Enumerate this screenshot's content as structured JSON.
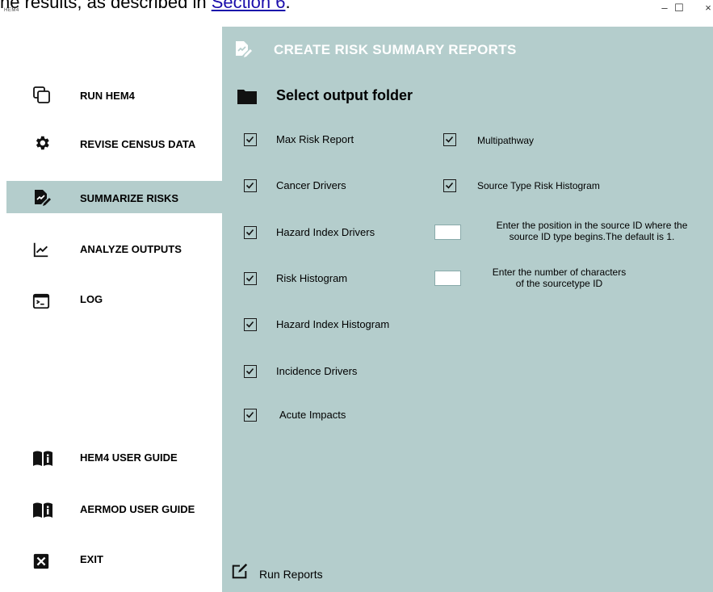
{
  "doc_top": {
    "text": "he results, as described in ",
    "link": "Section 6",
    "punct": "."
  },
  "window": {
    "app_title": "HEM4",
    "minimize": "–",
    "maximize": "☐",
    "close": "×"
  },
  "sidebar": {
    "items": [
      {
        "label": "RUN HEM4",
        "icon": "copy-icon"
      },
      {
        "label": "REVISE CENSUS DATA",
        "icon": "gear-icon"
      },
      {
        "label": "SUMMARIZE RISKS",
        "icon": "edit-document-icon",
        "active": true
      },
      {
        "label": "ANALYZE OUTPUTS",
        "icon": "chart-line-icon"
      },
      {
        "label": "LOG",
        "icon": "terminal-icon"
      },
      {
        "label": "HEM4 USER GUIDE",
        "icon": "book-info-icon"
      },
      {
        "label": "AERMOD USER GUIDE",
        "icon": "book-info-icon"
      },
      {
        "label": "EXIT",
        "icon": "close-box-icon"
      }
    ]
  },
  "main": {
    "title": "CREATE RISK SUMMARY REPORTS",
    "folder_label": "Select output folder",
    "left_checks": [
      {
        "label": "Max Risk Report",
        "checked": true
      },
      {
        "label": "Cancer Drivers",
        "checked": true
      },
      {
        "label": "Hazard Index Drivers",
        "checked": true
      },
      {
        "label": "Risk Histogram",
        "checked": true
      },
      {
        "label": "Hazard Index Histogram",
        "checked": true
      },
      {
        "label": "Incidence Drivers",
        "checked": true
      },
      {
        "label": "Acute Impacts",
        "checked": true
      }
    ],
    "right_checks": [
      {
        "label": "Multipathway",
        "checked": true
      },
      {
        "label": "Source Type Risk Histogram",
        "checked": true
      }
    ],
    "position_input": {
      "value": "",
      "help_line1": "Enter the position in the source ID where the",
      "help_line2": "source ID type begins.The default is 1."
    },
    "chars_input": {
      "value": "",
      "help_line1": "Enter the number of characters",
      "help_line2": "of the sourcetype ID"
    },
    "run_label": "Run Reports"
  },
  "colors": {
    "panel": "#b4cdcc",
    "title_text": "#ffffff"
  }
}
